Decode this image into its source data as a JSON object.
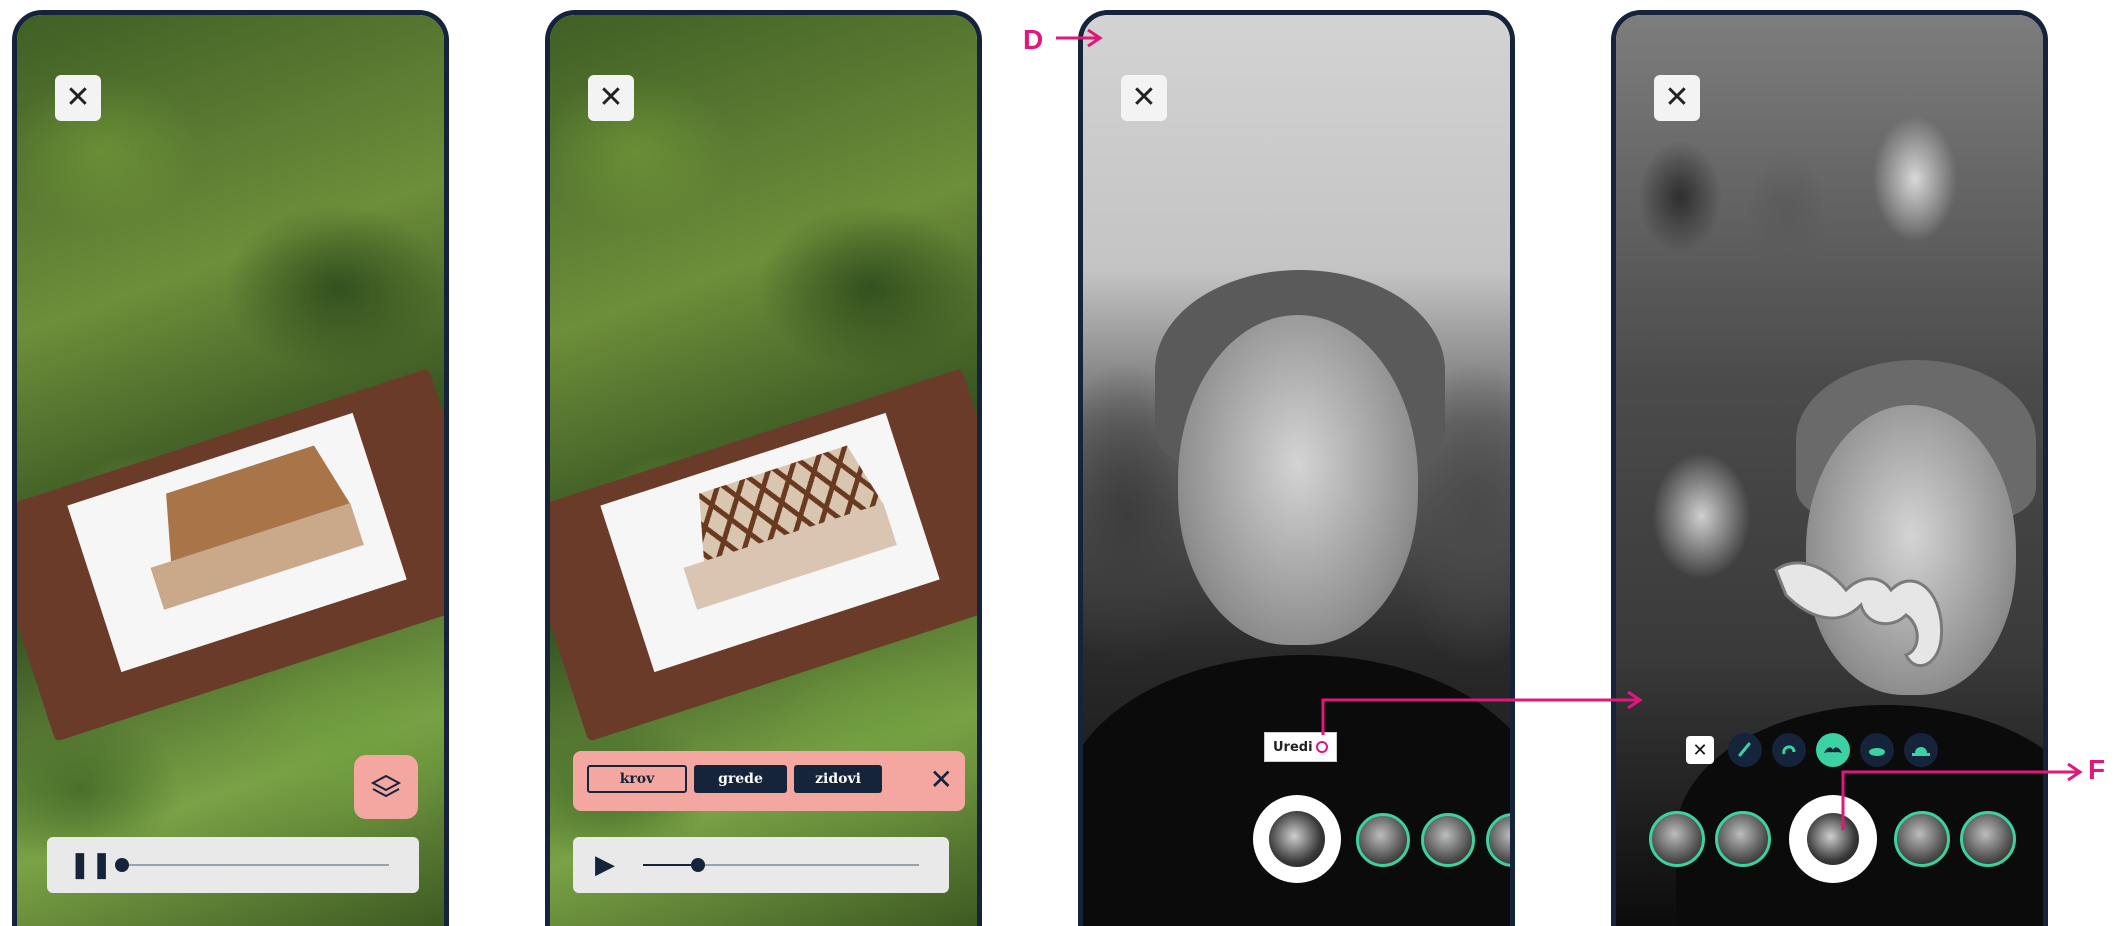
{
  "screens": [
    {
      "id": "ar-model-closed",
      "player": {
        "control": "pause",
        "progress": 0.02
      }
    },
    {
      "id": "ar-model-layers",
      "layers": [
        "krov",
        "grede",
        "zidovi"
      ],
      "active_layer": "krov",
      "player": {
        "control": "play",
        "progress": 0.2
      }
    },
    {
      "id": "photo-booth-portrait",
      "edit_label": "Uredi"
    },
    {
      "id": "photo-booth-edit",
      "tools": [
        "close-icon",
        "pencil-icon",
        "undo-icon",
        "mustache-icon",
        "hat-icon",
        "bowler-icon"
      ],
      "selected_tool": "mustache-icon"
    }
  ],
  "annotations": {
    "d": "D",
    "f": "F"
  },
  "colors": {
    "frame": "#15243a",
    "accent_pink": "#f4a7a1",
    "accent_green": "#3bd1a3",
    "annotation": "#e0177d"
  }
}
